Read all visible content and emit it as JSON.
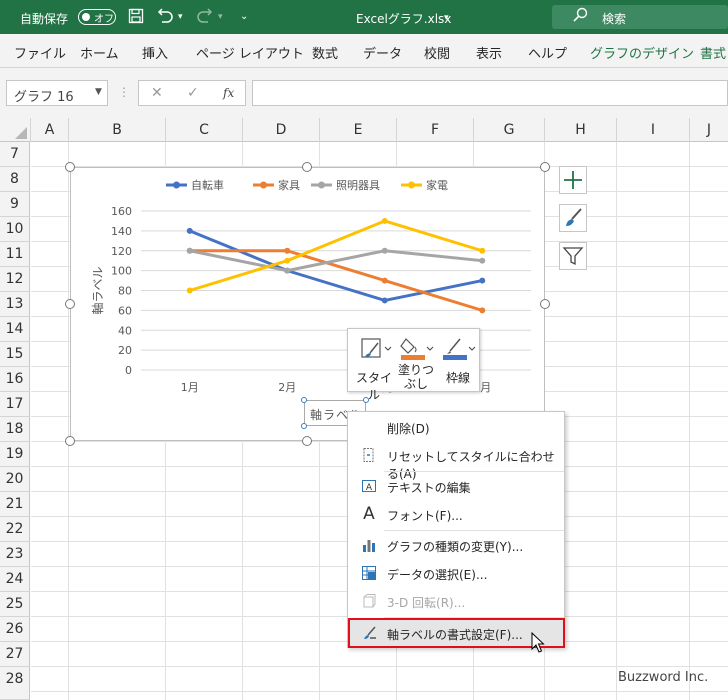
{
  "titlebar": {
    "autosave_label": "自動保存",
    "autosave_state": "オフ",
    "filename": "Excelグラフ.xlsx",
    "search_placeholder": "検索"
  },
  "ribbon": {
    "tabs": [
      "ファイル",
      "ホーム",
      "挿入",
      "ページ レイアウト",
      "数式",
      "データ",
      "校閲",
      "表示",
      "ヘルプ",
      "グラフのデザイン",
      "書式"
    ]
  },
  "formula_bar": {
    "name_box": "グラフ 16",
    "fx": "fx"
  },
  "grid": {
    "columns": [
      "A",
      "B",
      "C",
      "D",
      "E",
      "F",
      "G",
      "H",
      "I",
      "J"
    ],
    "rows": [
      "7",
      "8",
      "9",
      "10",
      "11",
      "12",
      "13",
      "14",
      "15",
      "16",
      "17",
      "18",
      "19",
      "20",
      "21",
      "22",
      "23",
      "24",
      "25",
      "26",
      "27",
      "28"
    ]
  },
  "chart_data": {
    "type": "line",
    "categories": [
      "1月",
      "2月",
      "3月",
      "4月"
    ],
    "ylabel": "軸ラベル",
    "ylim": [
      0,
      160
    ],
    "yticks": [
      "0",
      "20",
      "40",
      "60",
      "80",
      "100",
      "120",
      "140",
      "160"
    ],
    "legend_position": "top",
    "series": [
      {
        "name": "自転車",
        "color": "#4472c4",
        "values": [
          140,
          100,
          70,
          90
        ]
      },
      {
        "name": "家具",
        "color": "#ed7d31",
        "values": [
          120,
          120,
          90,
          60
        ]
      },
      {
        "name": "照明器具",
        "color": "#a5a5a5",
        "values": [
          120,
          100,
          120,
          110
        ]
      },
      {
        "name": "家電",
        "color": "#ffc000",
        "values": [
          80,
          110,
          150,
          120
        ]
      }
    ]
  },
  "minibar": {
    "style_label": "スタイル",
    "fill_label_1": "塗りつ",
    "fill_label_2": "ぶし",
    "border_label": "枠線"
  },
  "axis_label_box": "軸ラベル",
  "context_menu": {
    "items": [
      {
        "label": "削除(D)",
        "icon": "none",
        "disabled": false
      },
      {
        "label": "リセットしてスタイルに合わせる(A)",
        "icon": "reset-style-icon",
        "disabled": false
      },
      {
        "label": "テキストの編集",
        "icon": "edit-text-icon",
        "disabled": false
      },
      {
        "label": "フォント(F)...",
        "icon": "font-icon",
        "disabled": false
      },
      {
        "label": "グラフの種類の変更(Y)...",
        "icon": "chart-type-icon",
        "disabled": false
      },
      {
        "label": "データの選択(E)...",
        "icon": "select-data-icon",
        "disabled": false
      },
      {
        "label": "3-D 回転(R)...",
        "icon": "rotate-3d-icon",
        "disabled": true
      },
      {
        "label": "軸ラベルの書式設定(F)...",
        "icon": "format-icon",
        "disabled": false
      }
    ]
  },
  "watermark": "Buzzword Inc."
}
